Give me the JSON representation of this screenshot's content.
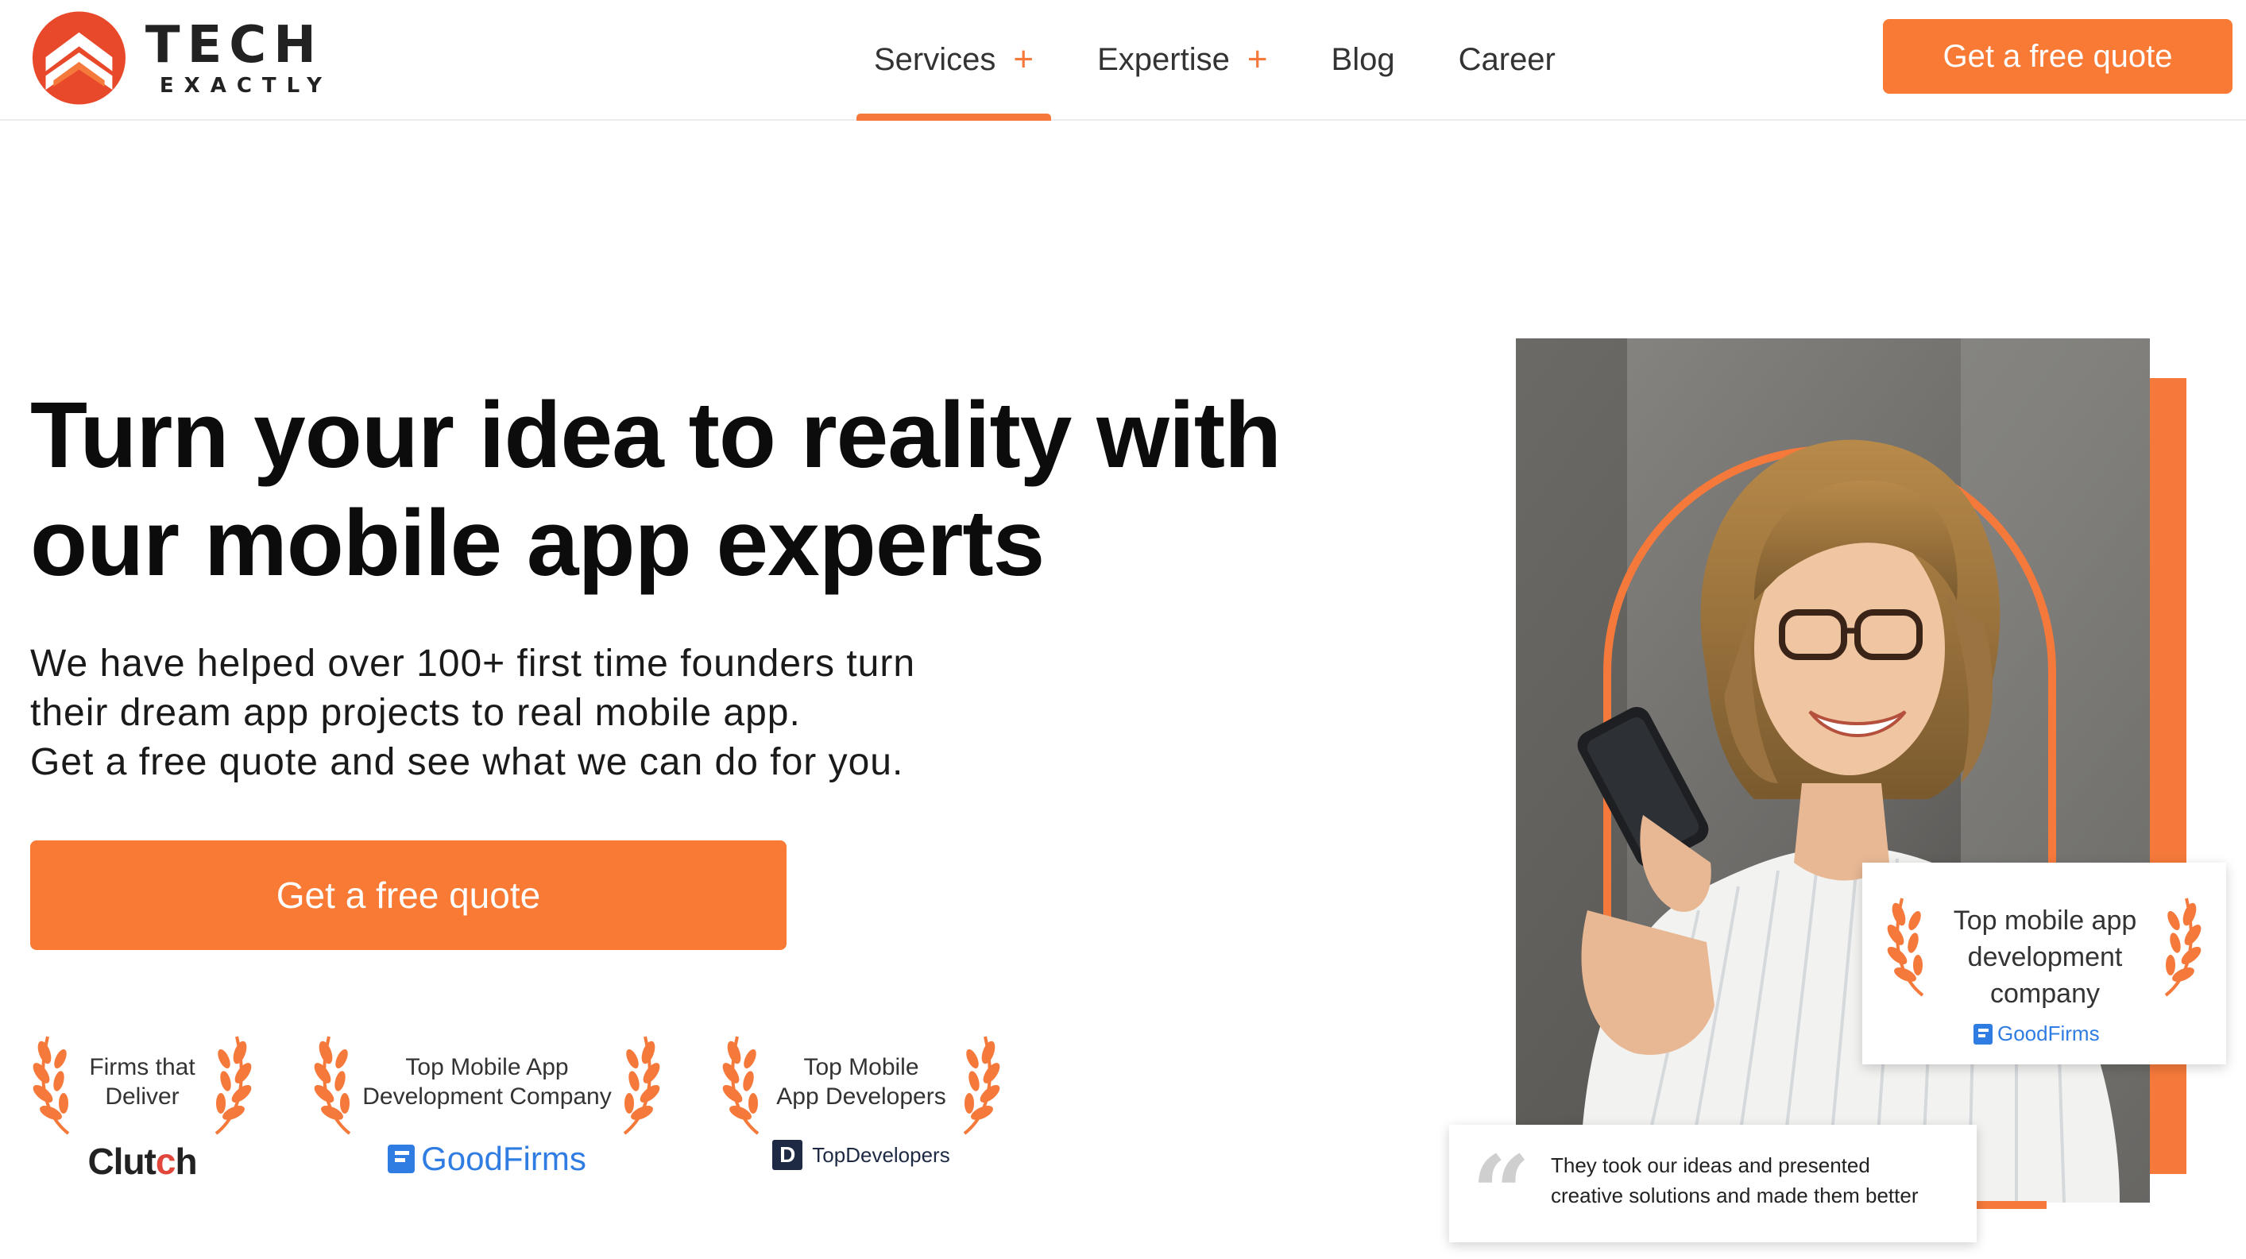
{
  "brand": {
    "logo_line1": "TECH",
    "logo_line2": "EXACTLY",
    "accent_color": "#f97a35",
    "logo_colors": [
      "#e8492a",
      "#f5793b"
    ]
  },
  "nav": {
    "items": [
      {
        "label": "Services",
        "has_submenu": true,
        "active": true
      },
      {
        "label": "Expertise",
        "has_submenu": true,
        "active": false
      },
      {
        "label": "Blog",
        "has_submenu": false,
        "active": false
      },
      {
        "label": "Career",
        "has_submenu": false,
        "active": false
      }
    ],
    "submenu_icon": "plus-icon",
    "cta_label": "Get a free quote"
  },
  "hero": {
    "title_line1": "Turn your idea to reality with",
    "title_line2": "our mobile app experts",
    "subtitle_line1": "We have helped over 100+ first time founders turn",
    "subtitle_line2": "their dream app projects to real mobile app.",
    "subtitle_line3": "Get a free quote and see what we can do for you.",
    "cta_label": "Get a free quote"
  },
  "badges": [
    {
      "line1": "Firms that",
      "line2": "Deliver",
      "brand": "Clutch"
    },
    {
      "line1": "Top Mobile App",
      "line2": "Development Company",
      "brand": "GoodFirms"
    },
    {
      "line1": "Top Mobile",
      "line2": "App Developers",
      "brand": "TopDevelopers",
      "brand_icon_letter": "D"
    }
  ],
  "award_card": {
    "line1": "Top mobile app",
    "line2": "development",
    "line3": "company",
    "brand": "GoodFirms"
  },
  "testimonial": {
    "line1": "They took our ideas and presented",
    "line2": "creative solutions and made them better"
  }
}
